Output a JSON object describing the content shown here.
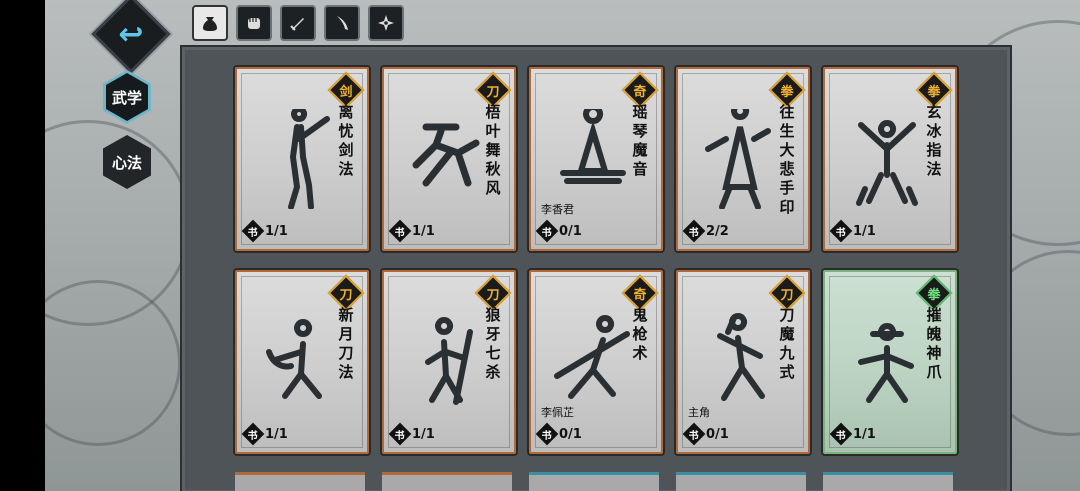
{
  "sidebar": {
    "back_icon": "back-arrow-icon",
    "tabs": [
      {
        "label": "武学",
        "active": true
      },
      {
        "label": "心法",
        "active": false
      }
    ]
  },
  "filters": [
    {
      "icon": "bag-icon",
      "selected": true
    },
    {
      "icon": "fist-icon",
      "selected": false
    },
    {
      "icon": "sword-icon",
      "selected": false
    },
    {
      "icon": "blade-icon",
      "selected": false
    },
    {
      "icon": "shuriken-icon",
      "selected": false
    }
  ],
  "book_glyph": "书",
  "cards": [
    {
      "type": "剑",
      "name": "离忧剑法",
      "owner": "",
      "count": "1/1",
      "highlight": false
    },
    {
      "type": "刀",
      "name": "梧叶舞秋风",
      "owner": "",
      "count": "1/1",
      "highlight": false
    },
    {
      "type": "奇",
      "name": "瑶琴魔音",
      "owner": "李香君",
      "count": "0/1",
      "highlight": false
    },
    {
      "type": "拳",
      "name": "往生大悲手印",
      "owner": "",
      "count": "2/2",
      "highlight": false
    },
    {
      "type": "拳",
      "name": "玄冰指法",
      "owner": "",
      "count": "1/1",
      "highlight": false
    },
    {
      "type": "刀",
      "name": "新月刀法",
      "owner": "",
      "count": "1/1",
      "highlight": false
    },
    {
      "type": "刀",
      "name": "狼牙七杀",
      "owner": "",
      "count": "1/1",
      "highlight": false
    },
    {
      "type": "奇",
      "name": "鬼枪术",
      "owner": "李佩芷",
      "count": "0/1",
      "highlight": false
    },
    {
      "type": "刀",
      "name": "刀魔九式",
      "owner": "主角",
      "count": "0/1",
      "highlight": false
    },
    {
      "type": "拳",
      "name": "摧魄神爪",
      "owner": "",
      "count": "1/1",
      "highlight": true
    }
  ]
}
